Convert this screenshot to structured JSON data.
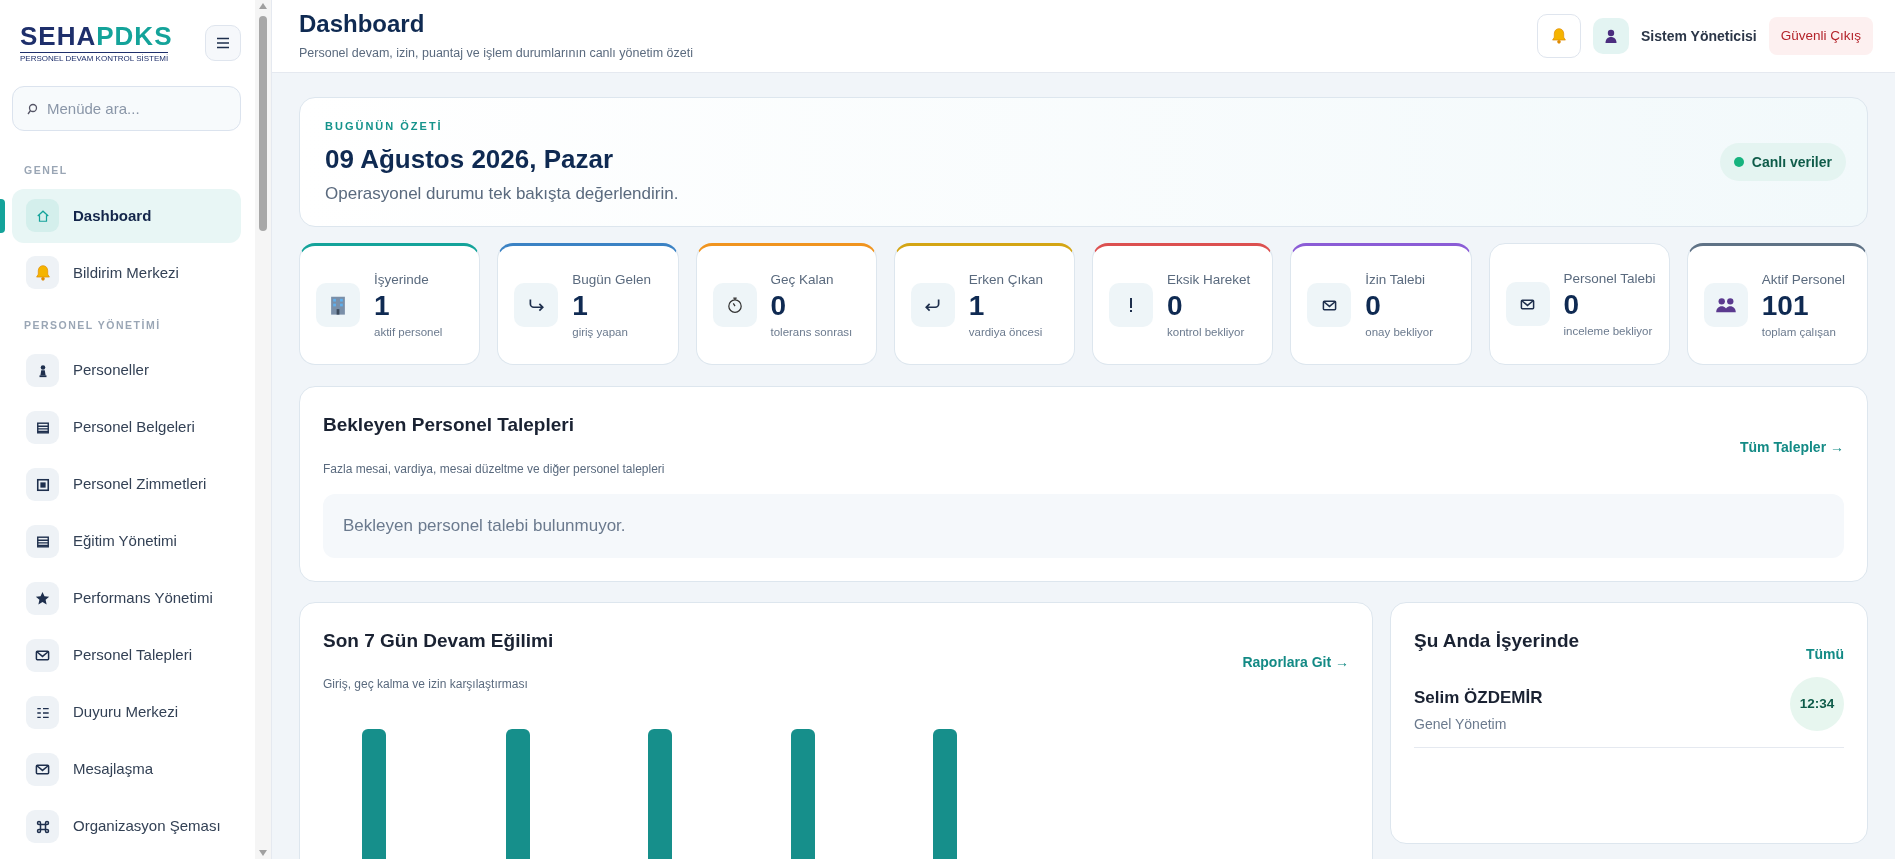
{
  "sidebar": {
    "logo_main": "SEHA",
    "logo_accent": "PDKS",
    "logo_tagline": "PERSONEL DEVAM KONTROL SİSTEMİ",
    "search": {
      "placeholder": "Menüde ara..."
    },
    "sections": [
      {
        "title": "GENEL",
        "items": [
          {
            "label": "Dashboard",
            "kind": "home",
            "selected": true
          },
          {
            "label": "Bildirim Merkezi",
            "kind": "bell",
            "selected": false
          }
        ]
      },
      {
        "title": "PERSONEL YÖNETİMİ",
        "items": [
          {
            "label": "Personeller",
            "kind": "person",
            "selected": false
          },
          {
            "label": "Personel Belgeleri",
            "kind": "list",
            "selected": false
          },
          {
            "label": "Personel Zimmetleri",
            "kind": "square",
            "selected": false
          },
          {
            "label": "Eğitim Yönetimi",
            "kind": "list",
            "selected": false
          },
          {
            "label": "Performans Yönetimi",
            "kind": "star",
            "selected": false
          },
          {
            "label": "Personel Talepleri",
            "kind": "mail",
            "selected": false
          },
          {
            "label": "Duyuru Merkezi",
            "kind": "grid",
            "selected": false
          },
          {
            "label": "Mesajlaşma",
            "kind": "mail",
            "selected": false
          },
          {
            "label": "Organizasyon Şeması",
            "kind": "command",
            "selected": false
          }
        ]
      }
    ]
  },
  "header": {
    "title": "Dashboard",
    "subtitle": "Personel devam, izin, puantaj ve işlem durumlarının canlı yönetim özeti",
    "user": "Sistem Yöneticisi",
    "logout": "Güvenli Çıkış"
  },
  "summary": {
    "eyebrow": "BUGÜNÜN ÖZETİ",
    "date": "09 Ağustos 2026, Pazar",
    "text": "Operasyonel durumu tek bakışta değerlendirin.",
    "badge": "Canlı veriler"
  },
  "stats": [
    {
      "label": "İşyerinde",
      "value": "1",
      "note": "aktif personel",
      "kind": "building",
      "color": "#14a39a"
    },
    {
      "label": "Bugün Gelen",
      "value": "1",
      "note": "giriş yapan",
      "kind": "arrow-in",
      "color": "#3b82c4"
    },
    {
      "label": "Geç Kalan",
      "value": "0",
      "note": "tolerans sonrası",
      "kind": "stopwatch",
      "color": "#f0941f"
    },
    {
      "label": "Erken Çıkan",
      "value": "1",
      "note": "vardiya öncesi",
      "kind": "arrow-back",
      "color": "#d4a514"
    },
    {
      "label": "Eksik Hareket",
      "value": "0",
      "note": "kontrol bekliyor",
      "kind": "exclaim",
      "color": "#dc5050"
    },
    {
      "label": "İzin Talebi",
      "value": "0",
      "note": "onay bekliyor",
      "kind": "mail",
      "color": "#8b5cd6"
    },
    {
      "label": "Personel Talebi",
      "value": "0",
      "note": "inceleme bekliyor",
      "kind": "mail"
    },
    {
      "label": "Aktif Personel",
      "value": "101",
      "note": "toplam çalışan",
      "kind": "people",
      "color": "#5f7286"
    }
  ],
  "pending": {
    "title": "Bekleyen Personel Talepleri",
    "subtitle": "Fazla mesai, vardiya, mesai düzeltme ve diğer personel talepleri",
    "link": "Tüm Talepler →",
    "empty": "Bekleyen personel talebi bulunmuyor."
  },
  "trend": {
    "title": "Son 7 Gün Devam Eğilimi",
    "subtitle": "Giriş, geç kalma ve izin karşılaştırması",
    "link": "Raporlara Git →"
  },
  "onsite": {
    "title": "Şu Anda İşyerinde",
    "link": "Tümü",
    "people": [
      {
        "name": "Selim ÖZDEMİR",
        "dept": "Genel Yönetim",
        "time": "12:34"
      }
    ]
  }
}
